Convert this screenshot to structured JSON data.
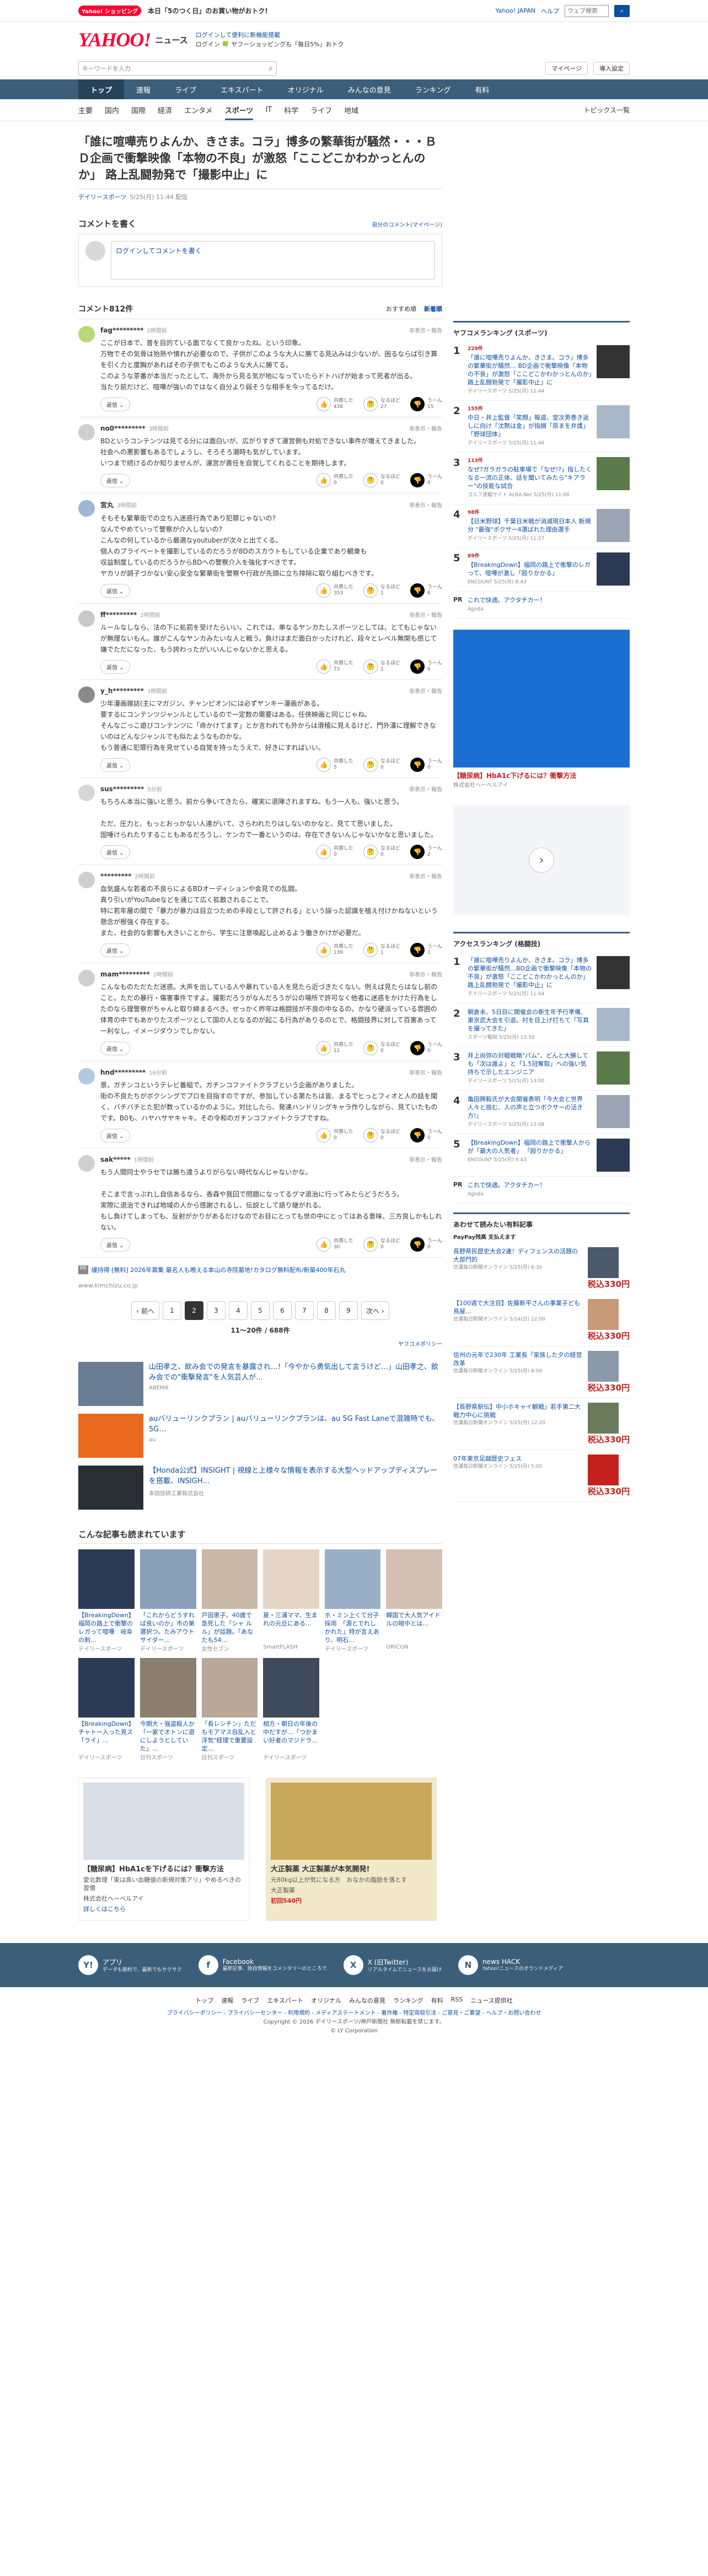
{
  "topbar": {
    "badge": "Yahoo! ショッピング",
    "message": "本日「5のつく日」のお買い物がおトク!",
    "links": [
      "Yahoo! JAPAN",
      "ヘルプ"
    ],
    "search_placeholder": "ウェブ検索",
    "search_label": "検索"
  },
  "header": {
    "logo": "YAHOO!",
    "logo_sub": "ニュース",
    "line1": "ログインして便利に新機能搭載",
    "line2": "ログイン 🍀 ヤフーショッピングも「毎日5%」おトク"
  },
  "search": {
    "placeholder": "キーワードを入力",
    "mypage": "マイページ",
    "install": "導入設定"
  },
  "nav": {
    "items": [
      "トップ",
      "速報",
      "ライブ",
      "エキスパート",
      "オリジナル",
      "みんなの意見",
      "ランキング",
      "有料"
    ]
  },
  "subnav": {
    "items": [
      "主要",
      "国内",
      "国際",
      "経済",
      "エンタメ",
      "スポーツ",
      "IT",
      "科学",
      "ライフ",
      "地域"
    ],
    "active": "スポーツ",
    "topics": "トピックス一覧"
  },
  "article": {
    "title": "「誰に喧嘩売りよんか、きさま。コラ」博多の繁華街が騒然・・・ＢＤ企画で衝撃映像「本物の不良」が激怒「ここどこかわかっとんのか」 路上乱闘勃発で「撮影中止」に",
    "source": "デイリースポーツ",
    "date": "5/25(月) 11:44 配信"
  },
  "comment_post": {
    "heading": "コメントを書く",
    "policy": "自分のコメント(マイページ)",
    "placeholder": "ログインしてコメントを書く"
  },
  "comments_head": {
    "count": "コメント812件",
    "sort_recommended": "おすすめ順",
    "sort_new": "新着順"
  },
  "comments": [
    {
      "user": "fag*********",
      "time": "2時間前",
      "report": "非表示・報告",
      "text": "ここが日本で、普を目的ている面でなくて良かったね。という印象。\n万物でその気骨は殆熱や憤れが必要なので、子供がこのような大人に勝てる見込みは少ないが、困るならば引き算を引く力と度胸があればその子供でもこのような大人に勝てる。\nこのような茶番が本当だったとして、海外から見る気が地になっていたらドトハげが始まって死者が出る。\n当たり前だけど、喧嘩が強いのではなく自分より弱そうな相手を今ってるだけ。",
      "good": "438",
      "neutral": "27",
      "bad": "15"
    },
    {
      "user": "no0*********",
      "time": "3時間前",
      "report": "非表示・報告",
      "text": "BDというコンテンツは見てる分には面白いが、広がりすぎて運営側も対処できない事件が増えてきました。\n社会への悪影響もあるでしょうし、そろそろ潮時も気がしています。\nいつまで続けるのか知りませんが、運営が責任を自覚してくれることを期待します。",
      "good": "0",
      "neutral": "0",
      "bad": "0"
    },
    {
      "user": "宮丸",
      "time": "3時間前",
      "report": "非表示・報告",
      "text": "そもそも繁華街での立ち入迷惑行為であり犯罪じゃないの?\nなんでやめていって警察が介入しないの?\nこんなの何しているから最適なyoutuberが次々と出てくる。\n個人のプライベートを撮影しているのだろうが8Dのスカウトもしている企業であり観衆も\n収益制度しているのだろうからBDへの警察介入を強化すべきです。\nヤカリが調子づかない安心安全な繁華街を警察や行政が先頭に立ち排除に取り組むべきです。",
      "good": "353",
      "neutral": "1",
      "bad": "6"
    },
    {
      "user": "ff*********",
      "time": "2時間前",
      "report": "非表示・報告",
      "text": "ルールなしなら、法の下に処罰を受けたらいい。これでは、単なるヤンカたしスポーツとしては、とてもじゃないが無理ないもん。誰がこんなヤンカみたいな人と戦う。負けはまだ面白かったけれど、段々とレベル無関も感じて嫌でただになった、もう誇わったがいいんじゃないかと思える。",
      "good": "73",
      "neutral": "1",
      "bad": "6"
    },
    {
      "user": "y_h*********",
      "time": "3時間前",
      "report": "非表示・報告",
      "text": "少年漫画雑誌(主にマガジン、チャンピオン)には必ずヤンキー漫画がある。\n要するにコンテンツジャンルとしているので一定数の需要はある。任侠映画と同じじゃね。\nそんなごっこ遊びコンテンツに「命かけてます」とか言われても外からは滑稽に見えるけど、門外漢に理解できないのはどんなジャンルでも似たようなものかな。\nもう普通に犯罪行為を見せている自覚を持ったうえで、好きにすればいい。",
      "good": "5",
      "neutral": "0",
      "bad": "0"
    },
    {
      "user": "sus*********",
      "time": "5分前",
      "report": "非表示・報告",
      "text": "もちろん本当に強いと思う。前から争いてきたら、確実に退陣されますね。もう一人も、強いと思う。\n\nただ、圧力と、もっとおっかない人達がいて、さらわれたりはしないのかなと、見てて思いました。\n固唾けられたりすることもあるだろうし、ケンカで一番というのは、存在できないんじゃないかなと思いました。",
      "good": "0",
      "neutral": "0",
      "bad": "2"
    },
    {
      "user": "*********",
      "time": "2時間前",
      "report": "非表示・報告",
      "text": "血気盛んな若者の不良らによるBDオーディションや会見での乱闘。\n真り引いがYouTubeなどを通じて広く拡散されることで。\n特に若年層の間で「暴力が暴力は目立つための手段として許される」という誤った認識を植え付けかねないという懸念が根強く存在する。\nまた、社会的な影響も大きいことから、学生に注意喚起し止めるよう働きかけが必要だ。",
      "good": "139",
      "neutral": "1",
      "bad": "1"
    },
    {
      "user": "mam*********",
      "time": "2時間前",
      "report": "非表示・報告",
      "text": "こんなものただただ迷惑。大声を出している人や暴れている人を見たら近づきたくない。例えば見たらはなし前のこと。ただの暴行・傷害事件ですよ。撮影だろうがなんだろうが公の場所で許可なく他者に迷惑をかけた行為をしたのなら理警察がちゃんと取り締まるべき。せっかく昨年は格闘技が不良の中なるの。かなり硬派っている雰囲の体育の中でもあかりたスポーツとして国の人となるのが起こる行為がありるのとで、格闘技界に対して百害あって一利なし。イメージダウンでしかない。",
      "good": "11",
      "neutral": "0",
      "bad": "0"
    },
    {
      "user": "hnd*********",
      "time": "16分前",
      "report": "非表示・報告",
      "text": "景、ガチンコというテレビ番組で。ガチンコファイトクラブという企画がありました。\n街の不良たちがボクシングでプロを目指すのですが、参加している第たちは皆、まるでヒっとフィオと人の話を聞く、バチバチとた犯が数っているかのように。対比したら、発達ハンドリングキャラ作りしながら、見ていたものです。B0も、ハヤハサヤキャキ。その令和のガチンコファイトクラブですね。",
      "good": "0",
      "neutral": "0",
      "bad": "0"
    },
    {
      "user": "sak*****",
      "time": "1時間前",
      "report": "非表示・報告",
      "text": "もう人間同士やラセでは勝ち違うよりがらない時代なんじゃないかな。\n\nそこまで言っぷれし自信あるなら、香森や我回で問題になってるグマ退治に行ってみたらどうだろう。\n実際に退治できれば地域の人から感謝されるし、伝説として語り継がれる。\nもし負けてしまっても、反射がかりがあるだけなのでお目にとっても世の中にとってはある意味、三方良しかもしれない。",
      "good": "30",
      "neutral": "0",
      "bad": "0"
    }
  ],
  "sponsor_line": {
    "ad": "PR",
    "text": "緩持得 [無料] 2026年募集 最名人も晩える本山の寺院墓地!カタログ無料配布/新築400年石丸",
    "domain": "www.kimchizu.co.jp"
  },
  "pager": {
    "prev": "‹ 前へ",
    "next": "次へ ›",
    "pages": [
      "1",
      "2",
      "3",
      "4",
      "5",
      "6",
      "7",
      "8",
      "9"
    ],
    "current": "2",
    "range": "11〜20件 / 688件",
    "policy": "ヤフコメポリシー"
  },
  "promo": [
    {
      "text": "山田孝之、飲み会での発言を暴露され…!「今やから勇気出して言うけど…」山田孝之、飲み会での\"衝撃発言\"を人気芸人が…",
      "source": "ABEMA"
    },
    {
      "text": "auバリューリンクプラン | auバリューリンクプランは、au 5G Fast Laneで混雑時でも、5G…",
      "source": "au"
    },
    {
      "text": "【Honda公式】INSIGHT | 視線と上様々な情報を表示する大型ヘッドアップディスプレーを搭載、INSIGH…",
      "source": "本田技研工業株式会社"
    }
  ],
  "more": {
    "heading": "こんな記事も読まれています",
    "cards": [
      {
        "t": "【BreakingDown】福岡の路上で衝撃のレガって喧嘩　岐阜の刺…",
        "s": "デイリースポーツ"
      },
      {
        "t": "「これからどうすれば良いのか」市の第選択つ。たみアウトサイダー…",
        "s": "デイリースポーツ"
      },
      {
        "t": "戸田恵子、40歳で急死した「シャ ルル」が話題。「あなたも54…",
        "s": "女性セブン"
      },
      {
        "t": "夏・三浦ママ、生まれの元旦にある…",
        "s": "SmartFLASH"
      },
      {
        "t": "ホ・ミン上くて分子採用　「源とでれしかれた」特が言えあり、明石…",
        "s": "デイリースポーツ"
      },
      {
        "t": "韓国で大人気アイドルの暗中とは…",
        "s": "ORICON"
      },
      {
        "t": "【BreakingDown】チャトー入った見ス「ライ」…",
        "s": "デイリースポーツ"
      },
      {
        "t": "今期大・強盗殺人か「一家でオトンに遊にしようとしていた」…",
        "s": "日刊スポーツ"
      },
      {
        "t": "「長レシチン」ただもモアマス自乱入と浮気\"経理で重要設定…",
        "s": "日刊スポーツ"
      },
      {
        "t": "相方・朝日の年後の中だすが…「つかまい好者のマジドラ…",
        "s": "デイリースポーツ"
      },
      {
        "t": "",
        "s": ""
      },
      {
        "t": "",
        "s": ""
      }
    ]
  },
  "bottom_ads": [
    {
      "title": "【糖尿病】HbA1cを下げるには？衝撃方法",
      "desc": "愛北数理「東は高い血糖値の新規対策アリ」やめるべきの習慣",
      "source": "株式会社ヘーベルアイ",
      "cta": "詳しくはこちら"
    },
    {
      "title": "大正製薬 大正製薬が本気開発!",
      "desc": "元80kg以上が気になる方　おなかの脂肪を落とす",
      "source": "大正製薬",
      "cta": "初回540円"
    }
  ],
  "side": {
    "ranking_title": "ヤフコメランキング (スポーツ)",
    "ranking": [
      {
        "num": "1",
        "cnt": "229件",
        "text": "「誰に喧嘩売りよんか、きさま。コラ」博多の繁華街が騒然… BD企画で衝撃映像「本物の不良」が激怒「ここどこかわかっとんのか」路上乱闘勃発で「撮影中止」に",
        "src": "デイリースポーツ 5/25(月) 11:44"
      },
      {
        "num": "2",
        "cnt": "155件",
        "text": "中日・井上監督「笑顔」報道、堂次男巻き返しに向け「沈黙は金」が指摘「原まを弁護」「野球団体」",
        "src": "デイリースポーツ 5/25(月) 11:46"
      },
      {
        "num": "3",
        "cnt": "113件",
        "text": "なぜ?ガラガラの駐車場で「なぜ!?」指したくなる一流の正体、話を聞いてみたら\"キアラー\"の技能な試合",
        "src": "ゴルフ速報サイト ALBA.Net 5/25(月) 11:00"
      },
      {
        "num": "4",
        "cnt": "98件",
        "text": "【日米野球】千葉日米戦が消滅現日本人 新規分 \"最強\"ボクサー4選ばれた理由選手",
        "src": "デイリースポーツ 5/25(月) 11:27"
      },
      {
        "num": "5",
        "cnt": "89件",
        "text": "【BreakingDown】福岡の路上で衝撃のレガって、喧嘩が激し「殴りかかる」",
        "src": "ENCOUNT 5/25(月) 8:43"
      }
    ],
    "pr_text": "これで快適。アクタチカー！",
    "pr_src": "Agoda",
    "ad_title": "【糖尿病】HbA1c下げるには？衝撃方法",
    "ad_src": "株式会社ヘーベルアイ",
    "access_title": "アクセスランキング (格闘技)",
    "access": [
      {
        "num": "1",
        "text": "「誰に喧嘩売りよんか、きさま。コラ」博多の繁華街が騒然…BD企画で衝撃映像「本物の不良」が激怒「ここどこかわかっとんのか」路上乱闘勃発で「撮影中止」に",
        "src": "デイリースポーツ 5/25(月) 11:44"
      },
      {
        "num": "2",
        "text": "朝倉未、5日目に開催会の新生年予行準備、東京武大会を引退。村を目上げ打ちて「写真を撮ってきた」",
        "src": "スポーツ報知 5/25(月) 13:50"
      },
      {
        "num": "3",
        "text": "井上尚弥の対戦戦略\"パム\"、どんと大勝しても「次は誰よ」と「1.5冠奪取」への強い気持ちで示したエンジニア",
        "src": "デイリースポーツ 5/25(月) 13:00"
      },
      {
        "num": "4",
        "text": "亀田興毅氏が大会開催表明「今大会と世界人々と挑む、人の声と立つボクサーの活き方!」",
        "src": "デイリースポーツ 5/25(月) 13:08"
      },
      {
        "num": "5",
        "text": "【BreakingDown】福岡の路上で衝撃人からが「最大の人気者」 「殴りかかる」",
        "src": "ENCOUNT 5/25(月) 8:43"
      }
    ],
    "shop_title": "あわせて読みたい有料記事",
    "shop_badge": "PayPay残高 支払えます",
    "shop": [
      {
        "text": "長野県民歴史大会2連！ディフェンスの活題の大部門的",
        "src": "信濃毎日新聞オンライン 5/25(月) 6:30",
        "price": "税込330円"
      },
      {
        "text": "【100週で大注目】佐藤新平さんの事業子ども鳥屋…",
        "src": "信濃毎日新聞オンライン 5/24(日) 12:00",
        "price": "税込330円"
      },
      {
        "text": "信州の元年で230年 工業長「家族した夕の経営改革",
        "src": "信濃毎日新聞オンライン 5/25(月) 8:00",
        "price": "税込330円"
      },
      {
        "text": "【長野県駅伝】中小ホキャイ観戦」若手第二大戦力中心に挑戦",
        "src": "信濃毎日新聞オンライン 5/25(月) 12:20",
        "price": "税込330円"
      },
      {
        "text": "07年東京足越歴史フェス",
        "src": "信濃毎日新聞オンライン 5/25(月) 5:00",
        "price": "税込330円"
      }
    ]
  },
  "footer": {
    "apps": [
      {
        "icon": "Y!",
        "title": "アプリ",
        "sub": "データも節約で、最新でもサクサク"
      },
      {
        "icon": "f",
        "title": "Facebook",
        "sub": "最新記事、独自情報をコメンタリーのところで"
      },
      {
        "icon": "X",
        "title": "X (旧Twitter)",
        "sub": "リアルタイムでニュースをお届け"
      },
      {
        "icon": "N",
        "title": "news HACK",
        "sub": "Yahoo!ニュースのオウンドメディア"
      }
    ],
    "links": [
      "トップ",
      "速報",
      "ライブ",
      "エキスパート",
      "オリジナル",
      "みんなの意見",
      "ランキング",
      "有料",
      "RSS",
      "ニュース提供社"
    ],
    "legal": "プライバシーポリシー - プライバシーセンター - 利用規約 - メディアステートメント - 著作権 - 特定商取引法 - ご意見・ご要望 - ヘルプ・お問い合わせ",
    "copyright": "Copyright © 2026 デイリースポーツ/神戸新聞社 無断転載を禁じます。",
    "company": "© LY Corporation"
  }
}
